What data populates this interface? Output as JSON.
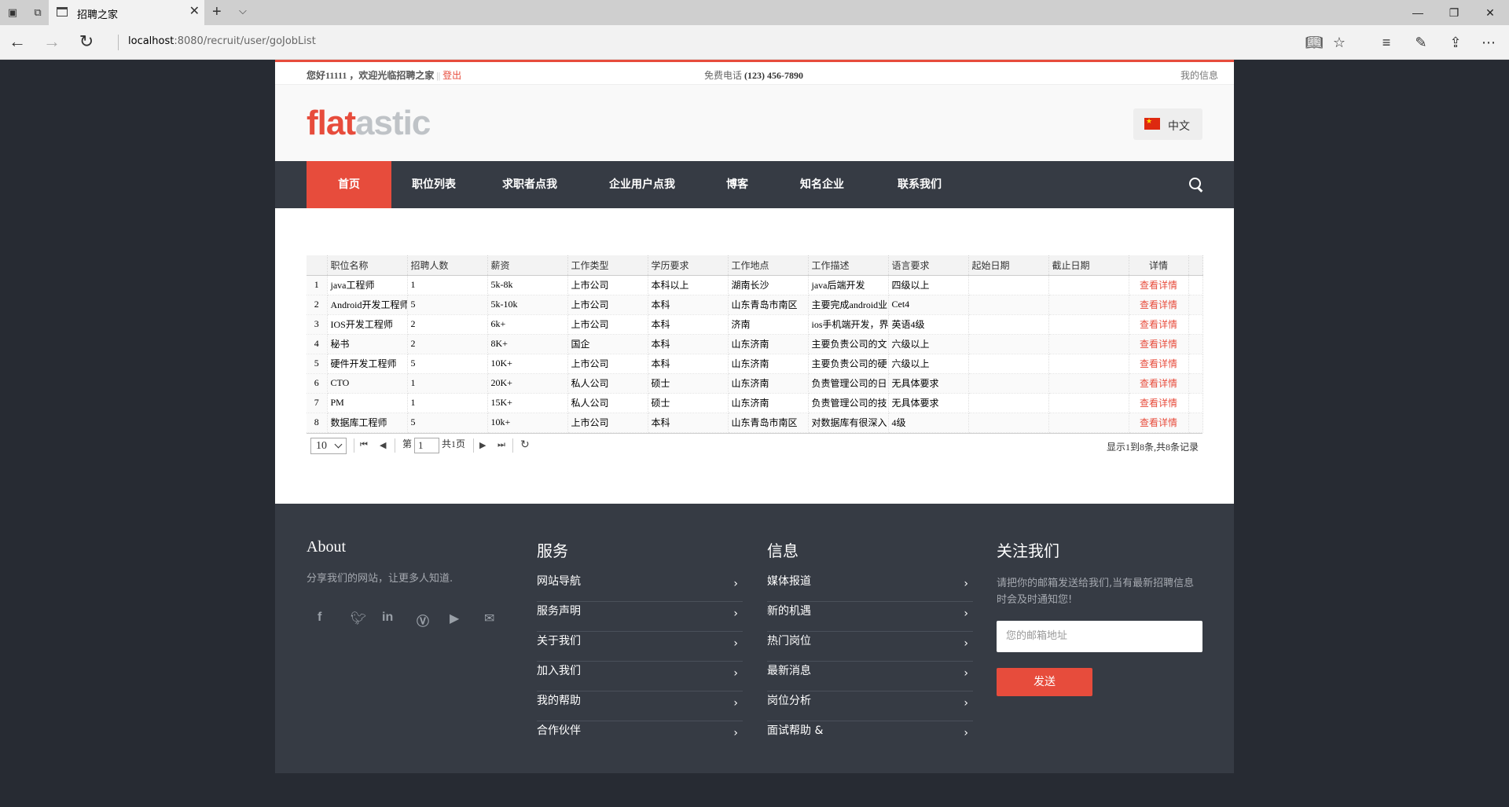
{
  "browser": {
    "tab_title": "招聘之家",
    "url_host": "localhost",
    "url_rest": ":8080/recruit/user/goJobList"
  },
  "topbar": {
    "greeting": "您好11111 ，欢迎光临招聘之家",
    "separator": "||",
    "logout": "登出",
    "phone_label": "免费电话",
    "phone_number": "(123) 456-7890",
    "my_info": "我的信息"
  },
  "header": {
    "logo_part1": "flat",
    "logo_part2": "astic",
    "language": "中文"
  },
  "nav": {
    "items": [
      {
        "label": "首页",
        "active": true
      },
      {
        "label": "职位列表"
      },
      {
        "label": "求职者点我"
      },
      {
        "label": "企业用户点我"
      },
      {
        "label": "博客"
      },
      {
        "label": "知名企业"
      },
      {
        "label": "联系我们"
      }
    ]
  },
  "table": {
    "columns": [
      "",
      "职位名称",
      "招聘人数",
      "薪资",
      "工作类型",
      "学历要求",
      "工作地点",
      "工作描述",
      "语言要求",
      "起始日期",
      "截止日期",
      "详情"
    ],
    "rows": [
      [
        "1",
        "java工程师",
        "1",
        "5k-8k",
        "上市公司",
        "本科以上",
        "湖南长沙",
        "java后端开发",
        "四级以上",
        "",
        "",
        "查看详情"
      ],
      [
        "2",
        "Android开发工程师",
        "5",
        "5k-10k",
        "上市公司",
        "本科",
        "山东青岛市南区",
        "主要完成android业",
        "Cet4",
        "",
        "",
        "查看详情"
      ],
      [
        "3",
        "IOS开发工程师",
        "2",
        "6k+",
        "上市公司",
        "本科",
        "济南",
        "ios手机端开发，界",
        "英语4级",
        "",
        "",
        "查看详情"
      ],
      [
        "4",
        "秘书",
        "2",
        "8K+",
        "国企",
        "本科",
        "山东济南",
        "主要负责公司的文",
        "六级以上",
        "",
        "",
        "查看详情"
      ],
      [
        "5",
        "硬件开发工程师",
        "5",
        "10K+",
        "上市公司",
        "本科",
        "山东济南",
        "主要负责公司的硬",
        "六级以上",
        "",
        "",
        "查看详情"
      ],
      [
        "6",
        "CTO",
        "1",
        "20K+",
        "私人公司",
        "硕士",
        "山东济南",
        "负责管理公司的日",
        "无具体要求",
        "",
        "",
        "查看详情"
      ],
      [
        "7",
        "PM",
        "1",
        "15K+",
        "私人公司",
        "硕士",
        "山东济南",
        "负责管理公司的技",
        "无具体要求",
        "",
        "",
        "查看详情"
      ],
      [
        "8",
        "数据库工程师",
        "5",
        "10k+",
        "上市公司",
        "本科",
        "山东青岛市南区",
        "对数据库有很深入",
        "4级",
        "",
        "",
        "查看详情"
      ]
    ]
  },
  "pager": {
    "page_size": "10",
    "page_prefix": "第",
    "current_page": "1",
    "page_total": "共1页",
    "info": "显示1到8条,共8条记录"
  },
  "footer": {
    "about_title": "About",
    "about_text": "分享我们的网站，让更多人知道.",
    "social_icons": [
      "facebook-icon",
      "twitter-icon",
      "linkedin-icon",
      "vimeo-icon",
      "youtube-icon",
      "mail-icon"
    ],
    "services_title": "服务",
    "services": [
      "网站导航",
      "服务声明",
      "关于我们",
      "加入我们",
      "我的帮助",
      "合作伙伴"
    ],
    "info_title": "信息",
    "info_items": [
      "媒体报道",
      "新的机遇",
      "热门岗位",
      "最新消息",
      "岗位分析",
      "面试帮助 &"
    ],
    "follow_title": "关注我们",
    "follow_text": "请把你的邮箱发送给我们,当有最新招聘信息时会及时通知您!",
    "email_placeholder": "您的邮箱地址",
    "send_label": "发送"
  },
  "colors": {
    "accent": "#e74c3c",
    "nav_bg": "#363b44",
    "body_bg": "#272b33"
  }
}
